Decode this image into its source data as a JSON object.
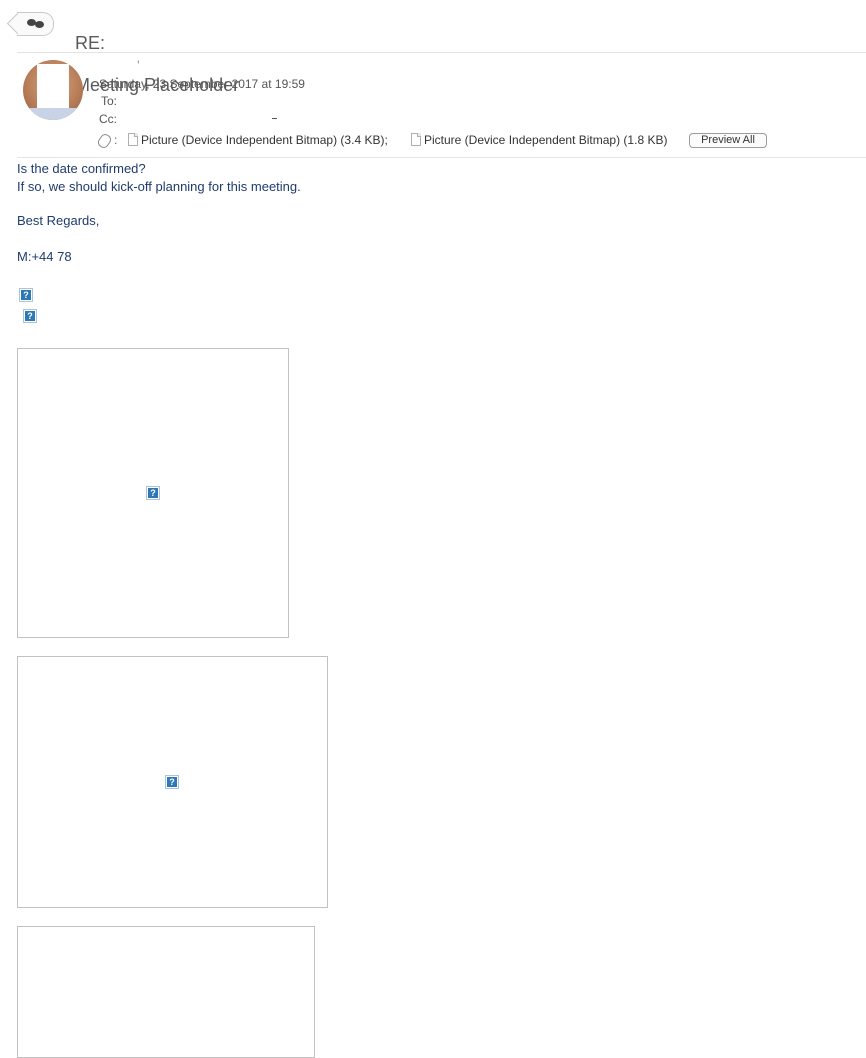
{
  "header": {
    "subject_prefix": "RE:",
    "subject_title": "Meeting Placeholder",
    "conversation_icon": "conversation-bubbles-icon"
  },
  "message": {
    "date": "Saturday, 23 September 2017 at 19:59",
    "to_label": "To:",
    "cc_label": "Cc:",
    "attachment_icon": "paperclip-icon",
    "attachments_colon": ":",
    "attachments": [
      {
        "label": "Picture (Device Independent Bitmap) (3.4 KB);"
      },
      {
        "label": "Picture (Device Independent Bitmap) (1.8 KB)"
      }
    ],
    "preview_all_label": "Preview All"
  },
  "body": {
    "line1": "Is the date confirmed?",
    "line2": "If so, we should kick-off planning for this meeting.",
    "closing": "Best Regards,",
    "phone": "M:+44 78"
  },
  "placeholders": {
    "broken_image_glyph": "?"
  }
}
